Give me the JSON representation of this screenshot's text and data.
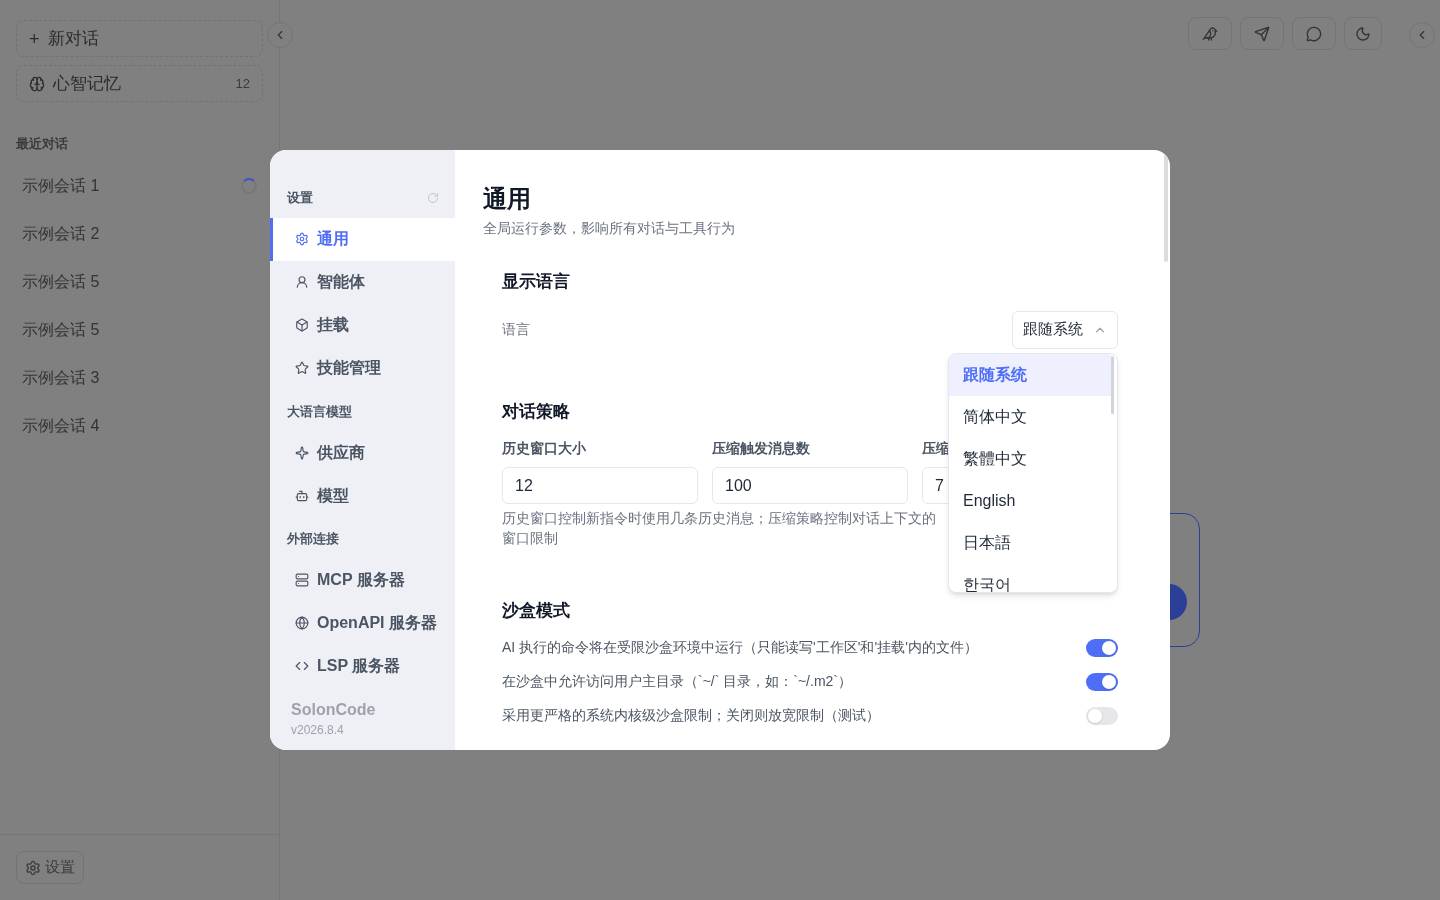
{
  "sidebar": {
    "new_chat": {
      "icon": "+",
      "label": "新对话"
    },
    "memory": {
      "label": "心智记忆",
      "count": "12"
    },
    "section_title": "最近对话",
    "conversations": [
      {
        "title": "示例会话 1",
        "loading": true
      },
      {
        "title": "示例会话 2",
        "loading": false
      },
      {
        "title": "示例会话 5",
        "loading": false
      },
      {
        "title": "示例会话 5",
        "loading": false
      },
      {
        "title": "示例会话 3",
        "loading": false
      },
      {
        "title": "示例会话 4",
        "loading": false
      }
    ],
    "settings_button": "设置"
  },
  "toolbar": [
    {
      "kind": "bird"
    },
    {
      "kind": "plane"
    },
    {
      "kind": "chat"
    },
    {
      "kind": "moon"
    }
  ],
  "settings": {
    "nav_title": "设置",
    "groups": [
      {
        "items": [
          {
            "label": "通用",
            "selected": true
          },
          {
            "label": "智能体",
            "selected": false
          },
          {
            "label": "挂载",
            "selected": false
          },
          {
            "label": "技能管理",
            "selected": false
          }
        ]
      },
      {
        "title": "大语言模型",
        "items": [
          {
            "label": "供应商",
            "selected": false
          },
          {
            "label": "模型",
            "selected": false
          }
        ]
      },
      {
        "title": "外部连接",
        "items": [
          {
            "label": "MCP 服务器",
            "selected": false
          },
          {
            "label": "OpenAPI 服务器",
            "selected": false
          },
          {
            "label": "LSP 服务器",
            "selected": false
          }
        ]
      }
    ],
    "app_name": "SolonCode",
    "version": "v2026.8.4",
    "page_title": "通用",
    "page_subtitle": "全局运行参数，影响所有对话与工具行为",
    "language_section": {
      "title": "显示语言",
      "label": "语言",
      "value": "跟随系统",
      "options": [
        {
          "label": "跟随系统",
          "selected": true
        },
        {
          "label": "简体中文",
          "selected": false
        },
        {
          "label": "繁體中文",
          "selected": false
        },
        {
          "label": "English",
          "selected": false
        },
        {
          "label": "日本語",
          "selected": false
        },
        {
          "label": "한국어",
          "selected": false
        }
      ]
    },
    "strategy_section": {
      "title": "对话策略",
      "fields": [
        {
          "label": "历史窗口大小",
          "value": "12"
        },
        {
          "label": "压缩触发消息数",
          "value": "100"
        },
        {
          "label": "压缩",
          "value": "7"
        }
      ],
      "help_lines": [
        "历史窗口控制新指令时使用几条历史消息；压缩策略控制对话上下文的",
        "窗口限制"
      ]
    },
    "sandbox_section": {
      "title": "沙盒模式",
      "toggles": [
        {
          "label": "AI 执行的命令将在受限沙盒环境中运行（只能读写'工作区'和'挂载'内的文件）",
          "on": true
        },
        {
          "label": "在沙盒中允许访问用户主目录（`~/` 目录，如：`~/.m2`）",
          "on": true
        },
        {
          "label": "采用更严格的系统内核级沙盒限制；关闭则放宽限制（测试）",
          "on": false
        }
      ]
    }
  }
}
